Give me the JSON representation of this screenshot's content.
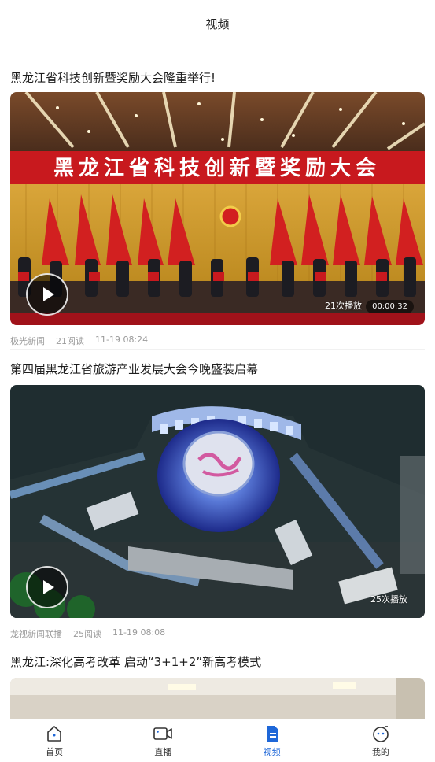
{
  "header": {
    "title": "视频"
  },
  "feed": [
    {
      "title": "黑龙江省科技创新暨奖励大会隆重举行!",
      "banner_text": "黑龙江省科技创新暨奖励大会",
      "plays": "21次播放",
      "duration": "00:00:32",
      "source": "极光新闻",
      "reads": "21阅读",
      "time": "11-19 08:24"
    },
    {
      "title": "第四届黑龙江省旅游产业发展大会今晚盛装启幕",
      "plays": "25次播放",
      "source": "龙视新闻联播",
      "reads": "25阅读",
      "time": "11-19 08:08"
    },
    {
      "title": "黑龙江:深化高考改革 启动“3+1+2”新高考模式"
    }
  ],
  "tabbar": {
    "items": [
      {
        "label": "首页",
        "icon": "home-icon"
      },
      {
        "label": "直播",
        "icon": "video-camera-icon"
      },
      {
        "label": "视频",
        "icon": "video-doc-icon",
        "active": true
      },
      {
        "label": "我的",
        "icon": "profile-icon"
      }
    ]
  },
  "colors": {
    "accent": "#1e67d8",
    "banner_red": "#c8191e"
  }
}
